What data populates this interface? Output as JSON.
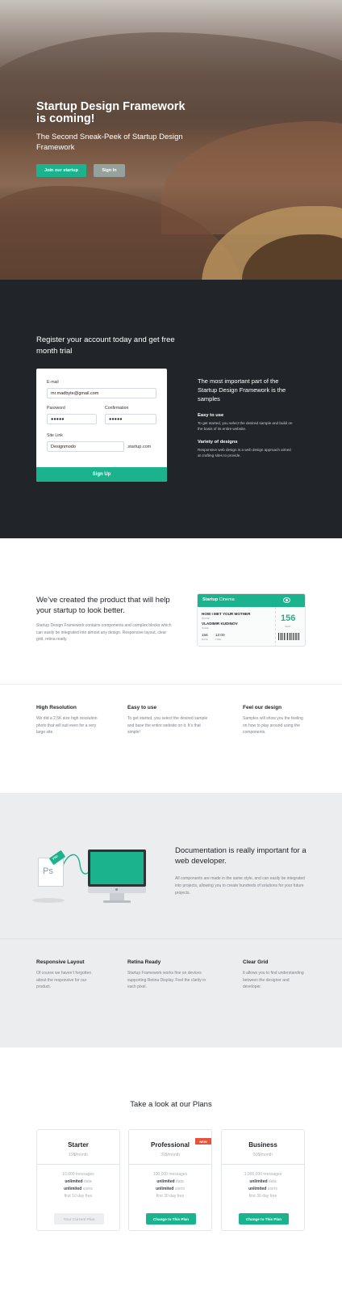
{
  "hero": {
    "title": "Startup Design Framework is coming!",
    "subtitle": "The Second Sneak-Peek of Startup Design Framework",
    "join_label": "Join our startup",
    "signin_label": "Sign In"
  },
  "register": {
    "heading": "Register your account today and get free month trial",
    "email_label": "E-mail",
    "email_value": "mr.madbyte@gmail.com",
    "password_label": "Password",
    "password_value": "●●●●●",
    "confirmation_label": "Confirmation",
    "confirmation_value": "●●●●●",
    "site_link_label": "Site Link",
    "site_link_value": "Designmodo",
    "site_suffix": ".startup.com",
    "signup_label": "Sign Up",
    "side_lead": "The most important part of the Startup Design Framework is the samples",
    "side_features": [
      {
        "title": "Easy to use",
        "text": "To get started, you select the desired sample and build on the basis of its entire website."
      },
      {
        "title": "Variety of designs",
        "text": "Responsive web design is a web design approach aimed at crafting sites to provide."
      }
    ]
  },
  "product": {
    "heading": "We’ve created the product that will help your startup to look better.",
    "text": "Startup Design Framework contains components and complex blocks which can easily be integrated into almost any design. Responsive layout, clear grid, retina ready.",
    "ticket": {
      "brand": "Startup",
      "brand_suffix": " Cinema",
      "movie": "HOW I MET YOUR MOTHER",
      "movie_caption": "MOVIE",
      "name": "VLADIMIR KUDINOV",
      "name_caption": "NAME",
      "date": "156",
      "date_caption": "DATE",
      "time": "12:00",
      "time_caption": "TIME",
      "seat": "156",
      "seat_caption": "SEAT"
    }
  },
  "features_1": [
    {
      "title": "High Resolution",
      "text": "We did a 2,5K size high resolution photo that will suit even for a very large site."
    },
    {
      "title": "Easy to use",
      "text": "To get started, you select the desired sample and base the entire website on it. It’s that simple!"
    },
    {
      "title": "Feel our design",
      "text": "Samples will show you the feeling on how to play around using the components."
    }
  ],
  "docs": {
    "heading": "Documentation is really important for a web developer.",
    "text": "All components are made in the same style, and can easily be integrated into projects, allowing you to create hundreds of solutions for your future projects.",
    "ps_label": "Ps",
    "psd_tag": "PSD"
  },
  "features_2": [
    {
      "title": "Responsive Layout",
      "text": "Of course we haven’t forgotten about the responsive for our product."
    },
    {
      "title": "Retina Ready",
      "text": "Startup Framework works fine on devices supporting Retina Display. Feel the clarity in each pixel."
    },
    {
      "title": "Clear Grid",
      "text": "It allows you to find understanding between the designer and developer."
    }
  ],
  "plans": {
    "heading": "Take a look at our Plans",
    "items": [
      {
        "name": "Starter",
        "price": "19$/month",
        "messages": "10,000 messages",
        "data": "unlimited",
        "data_suffix": " data",
        "users": "unlimited",
        "users_suffix": " users",
        "trial": "first 10 day free",
        "button": "Your Current Plan"
      },
      {
        "name": "Professional",
        "price": "39$/month",
        "messages": "100,000 messages",
        "data": "unlimited",
        "data_suffix": " data",
        "users": "unlimited",
        "users_suffix": " users",
        "trial": "first 30 day free",
        "button": "Change to This Plan",
        "badge": "NEW"
      },
      {
        "name": "Business",
        "price": "59$/month",
        "messages": "1,000,000 messages",
        "data": "unlimited",
        "data_suffix": " data",
        "users": "unlimited",
        "users_suffix": " users",
        "trial": "first 30 day free",
        "button": "Change to This Plan"
      }
    ]
  },
  "colors": {
    "accent": "#1bb38e",
    "dark": "#212428",
    "badge": "#e7523b"
  }
}
